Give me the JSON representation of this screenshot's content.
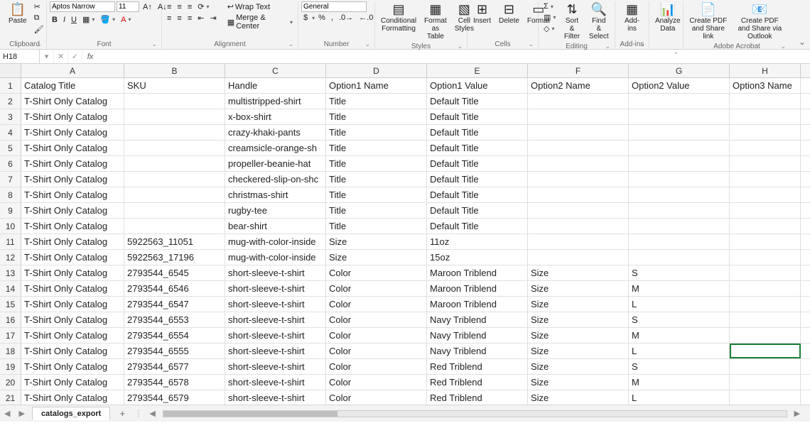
{
  "ribbon": {
    "clipboard": {
      "label": "Clipboard",
      "paste": "Paste"
    },
    "font": {
      "label": "Font",
      "name": "Aptos Narrow",
      "size": "11",
      "bold": "B",
      "italic": "I",
      "underline": "U"
    },
    "alignment": {
      "label": "Alignment",
      "wrap": "Wrap Text",
      "merge": "Merge & Center"
    },
    "number": {
      "label": "Number",
      "format": "General",
      "currency": "$",
      "percent": "%",
      "comma": ",",
      "inc": "",
      "dec": ""
    },
    "styles": {
      "label": "Styles",
      "cf": "Conditional\nFormatting",
      "fat": "Format as\nTable",
      "cs": "Cell\nStyles"
    },
    "cells": {
      "label": "Cells",
      "insert": "Insert",
      "delete": "Delete",
      "format": "Format"
    },
    "editing": {
      "label": "Editing",
      "sort": "Sort &\nFilter",
      "find": "Find &\nSelect"
    },
    "addins": {
      "label": "Add-ins",
      "addins": "Add-ins"
    },
    "analyze": {
      "analyze": "Analyze\nData"
    },
    "acrobat": {
      "label": "Adobe Acrobat",
      "pdf1": "Create PDF\nand Share link",
      "pdf2": "Create PDF and\nShare via Outlook"
    }
  },
  "formula_bar": {
    "name_box": "H18",
    "fx": "fx"
  },
  "columns": [
    "A",
    "B",
    "C",
    "D",
    "E",
    "F",
    "G",
    "H"
  ],
  "col_classes": [
    "cA",
    "cB",
    "cC",
    "cD",
    "cE",
    "cF",
    "cG",
    "cH"
  ],
  "selected": {
    "row": 18,
    "col": 7
  },
  "chart_data": {
    "type": "table",
    "headers": [
      "Catalog Title",
      "SKU",
      "Handle",
      "Option1 Name",
      "Option1 Value",
      "Option2 Name",
      "Option2 Value",
      "Option3 Name"
    ],
    "rows": [
      [
        "T-Shirt Only Catalog",
        "",
        "multistripped-shirt",
        "Title",
        "Default Title",
        "",
        "",
        ""
      ],
      [
        "T-Shirt Only Catalog",
        "",
        "x-box-shirt",
        "Title",
        "Default Title",
        "",
        "",
        ""
      ],
      [
        "T-Shirt Only Catalog",
        "",
        "crazy-khaki-pants",
        "Title",
        "Default Title",
        "",
        "",
        ""
      ],
      [
        "T-Shirt Only Catalog",
        "",
        "creamsicle-orange-sh",
        "Title",
        "Default Title",
        "",
        "",
        ""
      ],
      [
        "T-Shirt Only Catalog",
        "",
        "propeller-beanie-hat",
        "Title",
        "Default Title",
        "",
        "",
        ""
      ],
      [
        "T-Shirt Only Catalog",
        "",
        "checkered-slip-on-shc",
        "Title",
        "Default Title",
        "",
        "",
        ""
      ],
      [
        "T-Shirt Only Catalog",
        "",
        "christmas-shirt",
        "Title",
        "Default Title",
        "",
        "",
        ""
      ],
      [
        "T-Shirt Only Catalog",
        "",
        "rugby-tee",
        "Title",
        "Default Title",
        "",
        "",
        ""
      ],
      [
        "T-Shirt Only Catalog",
        "",
        "bear-shirt",
        "Title",
        "Default Title",
        "",
        "",
        ""
      ],
      [
        "T-Shirt Only Catalog",
        "5922563_11051",
        "mug-with-color-inside",
        "Size",
        "11oz",
        "",
        "",
        ""
      ],
      [
        "T-Shirt Only Catalog",
        "5922563_17196",
        "mug-with-color-inside",
        "Size",
        "15oz",
        "",
        "",
        ""
      ],
      [
        "T-Shirt Only Catalog",
        "2793544_6545",
        "short-sleeve-t-shirt",
        "Color",
        "Maroon Triblend",
        "Size",
        "S",
        ""
      ],
      [
        "T-Shirt Only Catalog",
        "2793544_6546",
        "short-sleeve-t-shirt",
        "Color",
        "Maroon Triblend",
        "Size",
        "M",
        ""
      ],
      [
        "T-Shirt Only Catalog",
        "2793544_6547",
        "short-sleeve-t-shirt",
        "Color",
        "Maroon Triblend",
        "Size",
        "L",
        ""
      ],
      [
        "T-Shirt Only Catalog",
        "2793544_6553",
        "short-sleeve-t-shirt",
        "Color",
        "Navy Triblend",
        "Size",
        "S",
        ""
      ],
      [
        "T-Shirt Only Catalog",
        "2793544_6554",
        "short-sleeve-t-shirt",
        "Color",
        "Navy Triblend",
        "Size",
        "M",
        ""
      ],
      [
        "T-Shirt Only Catalog",
        "2793544_6555",
        "short-sleeve-t-shirt",
        "Color",
        "Navy Triblend",
        "Size",
        "L",
        ""
      ],
      [
        "T-Shirt Only Catalog",
        "2793544_6577",
        "short-sleeve-t-shirt",
        "Color",
        "Red Triblend",
        "Size",
        "S",
        ""
      ],
      [
        "T-Shirt Only Catalog",
        "2793544_6578",
        "short-sleeve-t-shirt",
        "Color",
        "Red Triblend",
        "Size",
        "M",
        ""
      ],
      [
        "T-Shirt Only Catalog",
        "2793544_6579",
        "short-sleeve-t-shirt",
        "Color",
        "Red Triblend",
        "Size",
        "L",
        ""
      ]
    ]
  },
  "sheet_tab": "catalogs_export"
}
